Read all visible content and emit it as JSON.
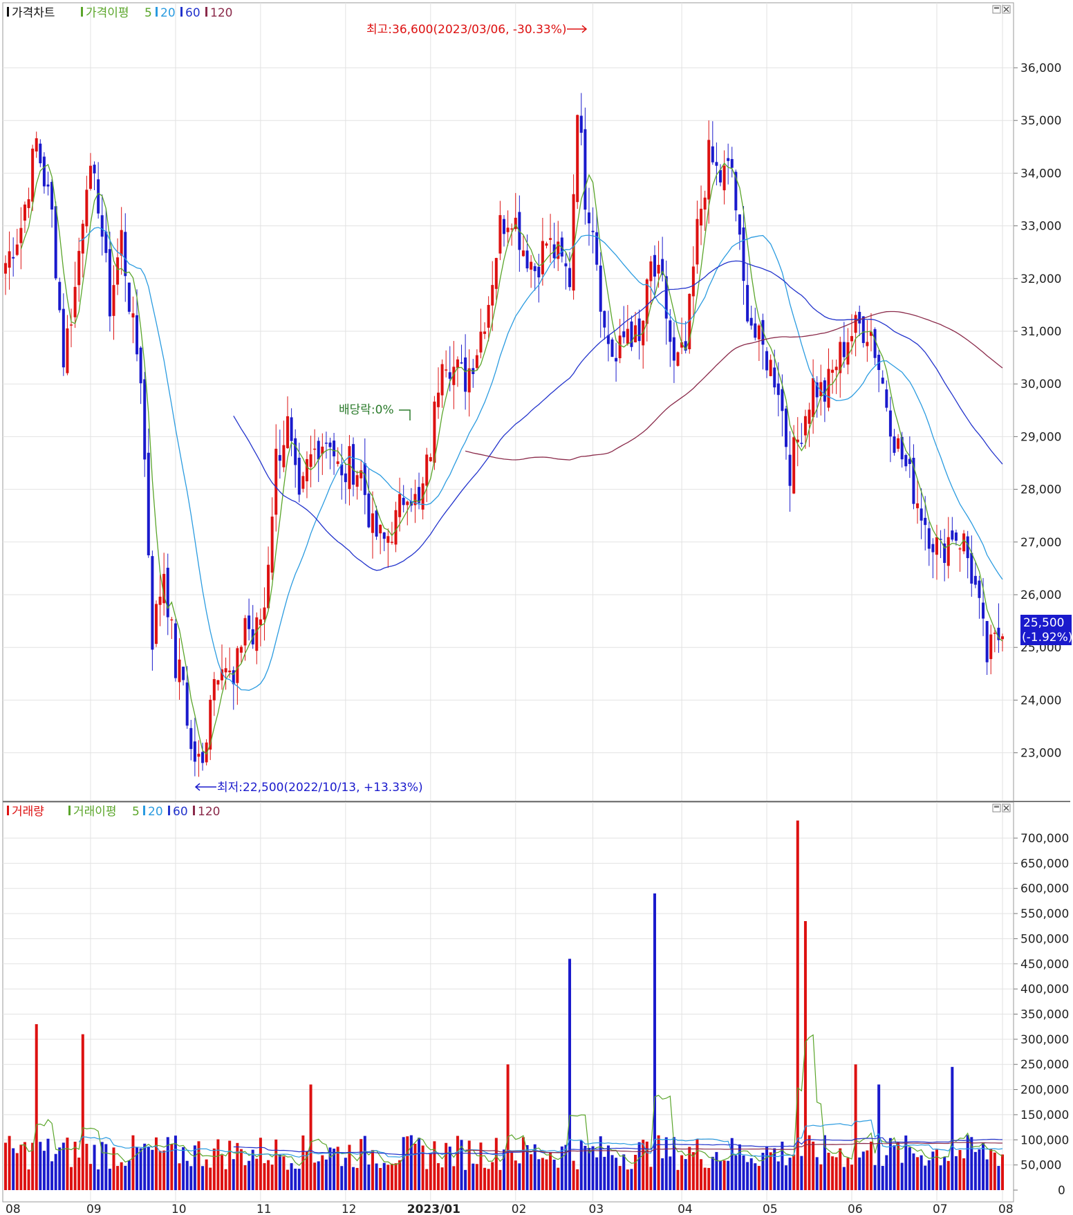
{
  "price_panel": {
    "legend": {
      "title": "가격차트",
      "ma_label": "가격이평",
      "ma_periods": [
        "5",
        "20",
        "60",
        "120"
      ]
    },
    "annotations": {
      "high": "최고:36,600(2023/03/06, -30.33%)",
      "low": "최저:22,500(2022/10/13, +13.33%)",
      "dividend": "배당락:0%"
    },
    "current_price": {
      "value": "25,500",
      "change": "(-1.92%)"
    },
    "y_ticks": [
      "36,000",
      "35,000",
      "34,000",
      "33,000",
      "32,000",
      "31,000",
      "30,000",
      "29,000",
      "28,000",
      "27,000",
      "26,000",
      "25,000",
      "24,000",
      "23,000"
    ]
  },
  "volume_panel": {
    "legend": {
      "title": "거래량",
      "ma_label": "거래이평",
      "ma_periods": [
        "5",
        "20",
        "60",
        "120"
      ]
    },
    "y_ticks": [
      "700,000",
      "650,000",
      "600,000",
      "550,000",
      "500,000",
      "450,000",
      "400,000",
      "350,000",
      "300,000",
      "250,000",
      "200,000",
      "150,000",
      "100,000",
      "50,000",
      "0"
    ]
  },
  "x_axis": {
    "labels": [
      "08",
      "09",
      "10",
      "11",
      "12",
      "2023/01",
      "02",
      "03",
      "04",
      "05",
      "06",
      "07",
      "08"
    ]
  },
  "colors": {
    "up": "#dd1111",
    "down": "#1a1acc",
    "ma5": "#5aa52a",
    "ma20": "#2a9be0",
    "ma60": "#2233cc",
    "ma120": "#8a2a4a"
  },
  "chart_data": {
    "type": "candlestick",
    "x": [
      "2022-08",
      "2022-09",
      "2022-10",
      "2022-11",
      "2022-12",
      "2023-01",
      "2023-02",
      "2023-03",
      "2023-04",
      "2023-05",
      "2023-06",
      "2023-07",
      "2023-08"
    ],
    "price_ylim": [
      22500,
      36600
    ],
    "volume_ylim": [
      0,
      700000
    ],
    "price_path": [
      [
        0,
        32300
      ],
      [
        4,
        33000
      ],
      [
        8,
        34600
      ],
      [
        12,
        33200
      ],
      [
        15,
        30500
      ],
      [
        18,
        31800
      ],
      [
        21,
        34000
      ],
      [
        24,
        33500
      ],
      [
        27,
        31500
      ],
      [
        30,
        32800
      ],
      [
        33,
        31000
      ],
      [
        35,
        30200
      ],
      [
        38,
        25200
      ],
      [
        41,
        26500
      ],
      [
        44,
        24600
      ],
      [
        46,
        24400
      ],
      [
        48,
        23000
      ],
      [
        51,
        22700
      ],
      [
        53,
        24200
      ],
      [
        56,
        24900
      ],
      [
        59,
        24200
      ],
      [
        62,
        25600
      ],
      [
        64,
        25100
      ],
      [
        67,
        25800
      ],
      [
        70,
        28600
      ],
      [
        73,
        29200
      ],
      [
        76,
        27600
      ],
      [
        78,
        28400
      ],
      [
        81,
        28900
      ],
      [
        84,
        29000
      ],
      [
        87,
        28100
      ],
      [
        89,
        28500
      ],
      [
        92,
        28300
      ],
      [
        95,
        27200
      ],
      [
        98,
        27000
      ],
      [
        101,
        27400
      ],
      [
        104,
        28100
      ],
      [
        107,
        27600
      ],
      [
        110,
        28800
      ],
      [
        113,
        30700
      ],
      [
        116,
        30300
      ],
      [
        119,
        30100
      ],
      [
        122,
        30700
      ],
      [
        125,
        31600
      ],
      [
        128,
        33000
      ],
      [
        131,
        33300
      ],
      [
        134,
        32600
      ],
      [
        137,
        32200
      ],
      [
        140,
        32700
      ],
      [
        143,
        32400
      ],
      [
        146,
        32000
      ],
      [
        148,
        35400
      ],
      [
        150,
        33600
      ],
      [
        152,
        33100
      ],
      [
        155,
        31000
      ],
      [
        158,
        30400
      ],
      [
        161,
        31100
      ],
      [
        164,
        30700
      ],
      [
        167,
        32200
      ],
      [
        170,
        31800
      ],
      [
        173,
        30300
      ],
      [
        176,
        30600
      ],
      [
        179,
        32900
      ],
      [
        182,
        34300
      ],
      [
        185,
        33900
      ],
      [
        188,
        34100
      ],
      [
        191,
        31800
      ],
      [
        194,
        30900
      ],
      [
        197,
        30500
      ],
      [
        200,
        30000
      ],
      [
        203,
        28400
      ],
      [
        206,
        29200
      ],
      [
        209,
        30000
      ],
      [
        212,
        29800
      ],
      [
        215,
        30400
      ],
      [
        218,
        30900
      ],
      [
        221,
        31100
      ],
      [
        224,
        31000
      ],
      [
        227,
        30000
      ],
      [
        230,
        29000
      ],
      [
        233,
        28400
      ],
      [
        236,
        27800
      ],
      [
        239,
        27200
      ],
      [
        242,
        26800
      ],
      [
        245,
        27200
      ],
      [
        248,
        27000
      ],
      [
        251,
        26100
      ],
      [
        254,
        24800
      ],
      [
        257,
        25200
      ],
      [
        258,
        25500
      ]
    ],
    "volume_spikes": [
      {
        "x": "2022-08",
        "value": 330000
      },
      {
        "x": "2022-08",
        "value": 310000
      },
      {
        "x": "2022-11",
        "value": 210000
      },
      {
        "x": "2023-01",
        "value": 250000
      },
      {
        "x": "2023-02",
        "value": 460000
      },
      {
        "x": "2023-03",
        "value": 590000
      },
      {
        "x": "2023-04",
        "value": 735000
      },
      {
        "x": "2023-04",
        "value": 535000
      },
      {
        "x": "2023-05",
        "value": 250000
      },
      {
        "x": "2023-06",
        "value": 210000
      },
      {
        "x": "2023-07",
        "value": 245000
      }
    ],
    "ma_periods": [
      5,
      20,
      60,
      120
    ]
  }
}
